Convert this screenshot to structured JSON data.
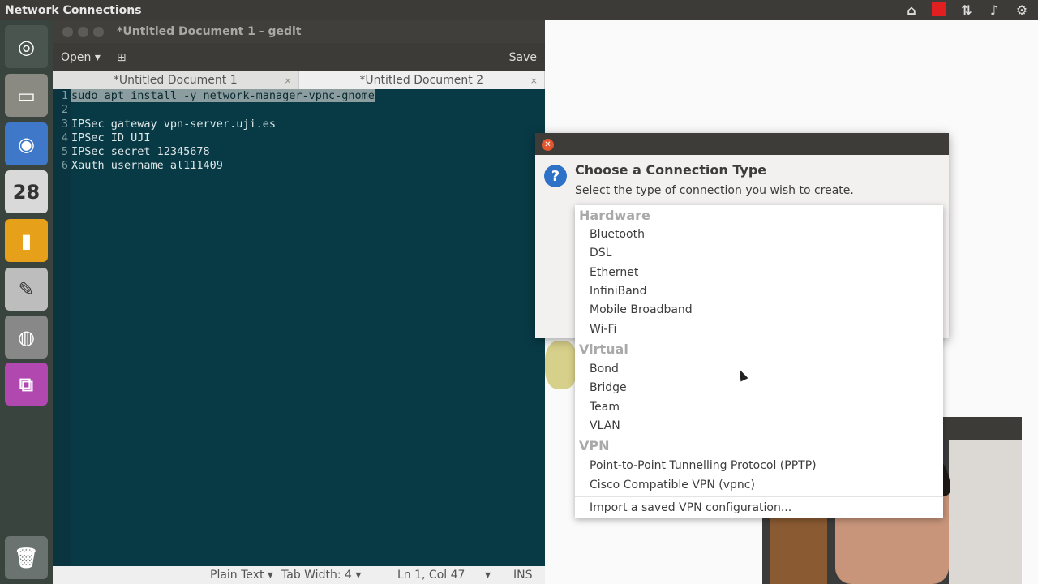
{
  "topbar": {
    "title": "Network Connections",
    "tray_icons": [
      "network-icon",
      "record-icon",
      "transfer-icon",
      "volume-icon",
      "gear-icon"
    ]
  },
  "launcher": {
    "items": [
      {
        "name": "ubuntu-dash-icon",
        "glyph": "◎"
      },
      {
        "name": "files-icon",
        "glyph": "▭"
      },
      {
        "name": "chromium-icon",
        "glyph": "◉"
      },
      {
        "name": "calendar-icon",
        "glyph": "28"
      },
      {
        "name": "notes-icon",
        "glyph": "▮"
      },
      {
        "name": "text-editor-icon",
        "glyph": "✎"
      },
      {
        "name": "webcam-icon",
        "glyph": "◍"
      },
      {
        "name": "network-connections-icon",
        "glyph": "⧉"
      },
      {
        "name": "trash-icon",
        "glyph": "🗑"
      }
    ]
  },
  "gedit": {
    "title": "*Untitled Document 1 - gedit",
    "open_label": "Open",
    "pin_glyph": "⊞",
    "save_label": "Save",
    "tabs": [
      {
        "label": "*Untitled Document 1",
        "close": "×"
      },
      {
        "label": "*Untitled Document 2",
        "close": "×"
      }
    ],
    "lines": [
      {
        "num": "1",
        "text": "sudo apt install -y network-manager-vpnc-gnome"
      },
      {
        "num": "2",
        "text": ""
      },
      {
        "num": "3",
        "text": "IPSec gateway vpn-server.uji.es"
      },
      {
        "num": "4",
        "text": "IPSec ID UJI"
      },
      {
        "num": "5",
        "text": "IPSec secret 12345678"
      },
      {
        "num": "6",
        "text": "Xauth username al111409"
      }
    ],
    "status": {
      "mode": "Plain Text ▾",
      "tab_width": "Tab Width: 4 ▾",
      "position": "Ln 1, Col 47",
      "dropdown": "▾",
      "ins": "INS"
    }
  },
  "dialog": {
    "close": "✕",
    "question": "?",
    "heading": "Choose a Connection Type",
    "subtitle": "Select the type of connection you wish to create."
  },
  "menu": {
    "hardware_header": "Hardware",
    "hardware": [
      "Bluetooth",
      "DSL",
      "Ethernet",
      "InfiniBand",
      "Mobile Broadband",
      "Wi-Fi"
    ],
    "virtual_header": "Virtual",
    "virtual": [
      "Bond",
      "Bridge",
      "Team",
      "VLAN"
    ],
    "vpn_header": "VPN",
    "vpn": [
      "Point-to-Point Tunnelling Protocol (PPTP)",
      "Cisco Compatible VPN (vpnc)"
    ],
    "import": "Import a saved VPN configuration..."
  }
}
